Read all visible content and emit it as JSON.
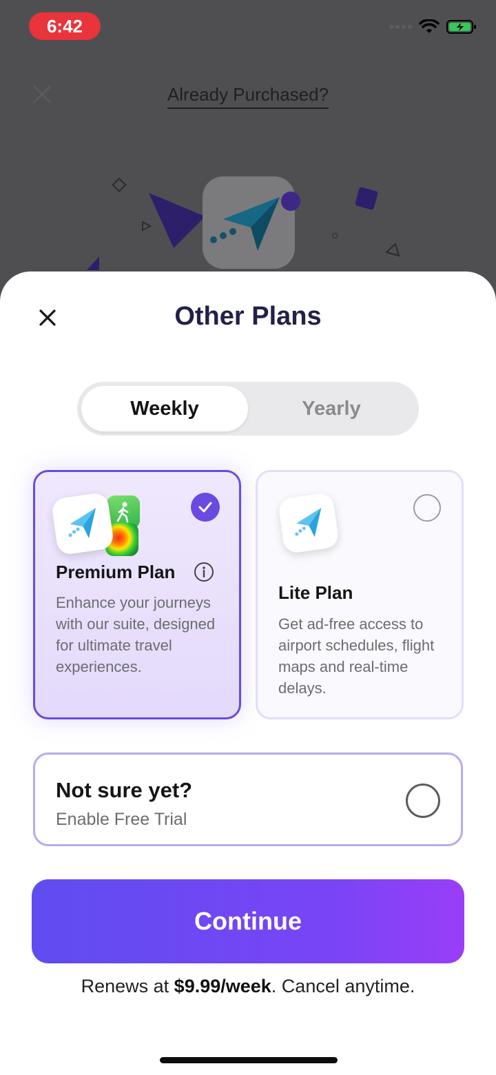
{
  "status_bar": {
    "time": "6:42"
  },
  "background": {
    "already_purchased": "Already Purchased?"
  },
  "sheet": {
    "title": "Other Plans",
    "segments": [
      {
        "label": "Weekly",
        "selected": true
      },
      {
        "label": "Yearly",
        "selected": false
      }
    ],
    "plans": [
      {
        "name": "Premium Plan",
        "description": "Enhance your journeys with our suite, designed for ultimate travel experiences.",
        "selected": true
      },
      {
        "name": "Lite Plan",
        "description": "Get ad-free access to airport schedules, flight maps and real-time delays.",
        "selected": false
      }
    ],
    "trial": {
      "title": "Not sure yet?",
      "subtitle": "Enable Free Trial",
      "selected": false
    },
    "continue_label": "Continue",
    "renew": {
      "prefix": "Renews at ",
      "price": "$9.99/week",
      "suffix": ". Cancel anytime."
    }
  },
  "colors": {
    "accent": "#6a4ae0",
    "title": "#23214a",
    "status_pill": "#e8343a"
  }
}
